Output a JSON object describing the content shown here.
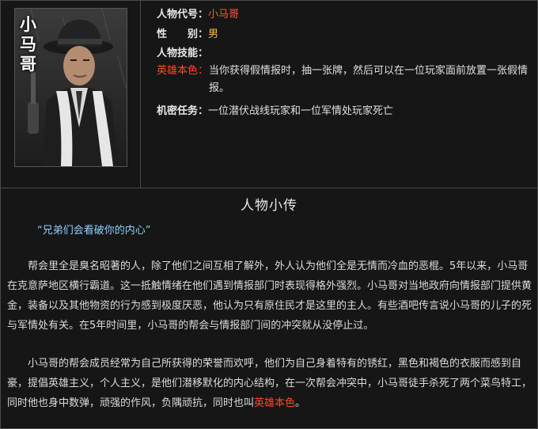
{
  "portrait": {
    "name_vertical": [
      "小",
      "马",
      "哥"
    ]
  },
  "info": {
    "code_label": "人物代号：",
    "code_value": "小马哥",
    "gender_label": "性　　别：",
    "gender_value": "男",
    "skill_label": "人物技能：",
    "skill_name": "英雄本色：",
    "skill_text": "当你获得假情报时，抽一张牌，然后可以在一位玩家面前放置一张假情报。",
    "mission_label": "机密任务：",
    "mission_text": "一位潜伏战线玩家和一位军情处玩家死亡"
  },
  "bio": {
    "title": "人物小传",
    "quote": "“兄弟们会看破你的内心”",
    "para1": "帮会里全是臭名昭著的人，除了他们之间互相了解外，外人认为他们全是无情而冷血的恶棍。5年以来，小马哥在克意萨地区横行霸道。这一抵触情绪在他们遇到情报部门时表现得格外强烈。小马哥对当地政府向情报部门提供黄金，装备以及其他物资的行为感到极度厌恶，他认为只有原住民才是这里的主人。有些酒吧传言说小马哥的儿子的死与军情处有关。在5年时间里，小马哥的帮会与情报部门间的冲突就从没停止过。",
    "para2_main": "小马哥的帮会成员经常为自己所获得的荣誉而欢呼，他们为自己身着特有的锈红，黑色和褐色的衣服而感到自豪，提倡英雄主义，个人主义，是他们潜移默化的内心结构，在一次帮会冲突中，小马哥徒手杀死了两个菜鸟特工，同时他也身中数弹，顽强的作风，负隅顽抗，同时也叫",
    "para2_highlight": "英雄本色",
    "para2_end": "。"
  },
  "colors": {
    "label_red": "#ff5a3c",
    "gender_yellow": "#f0c040",
    "quote_blue": "#8fd0ff",
    "border": "#4a4a4a"
  }
}
